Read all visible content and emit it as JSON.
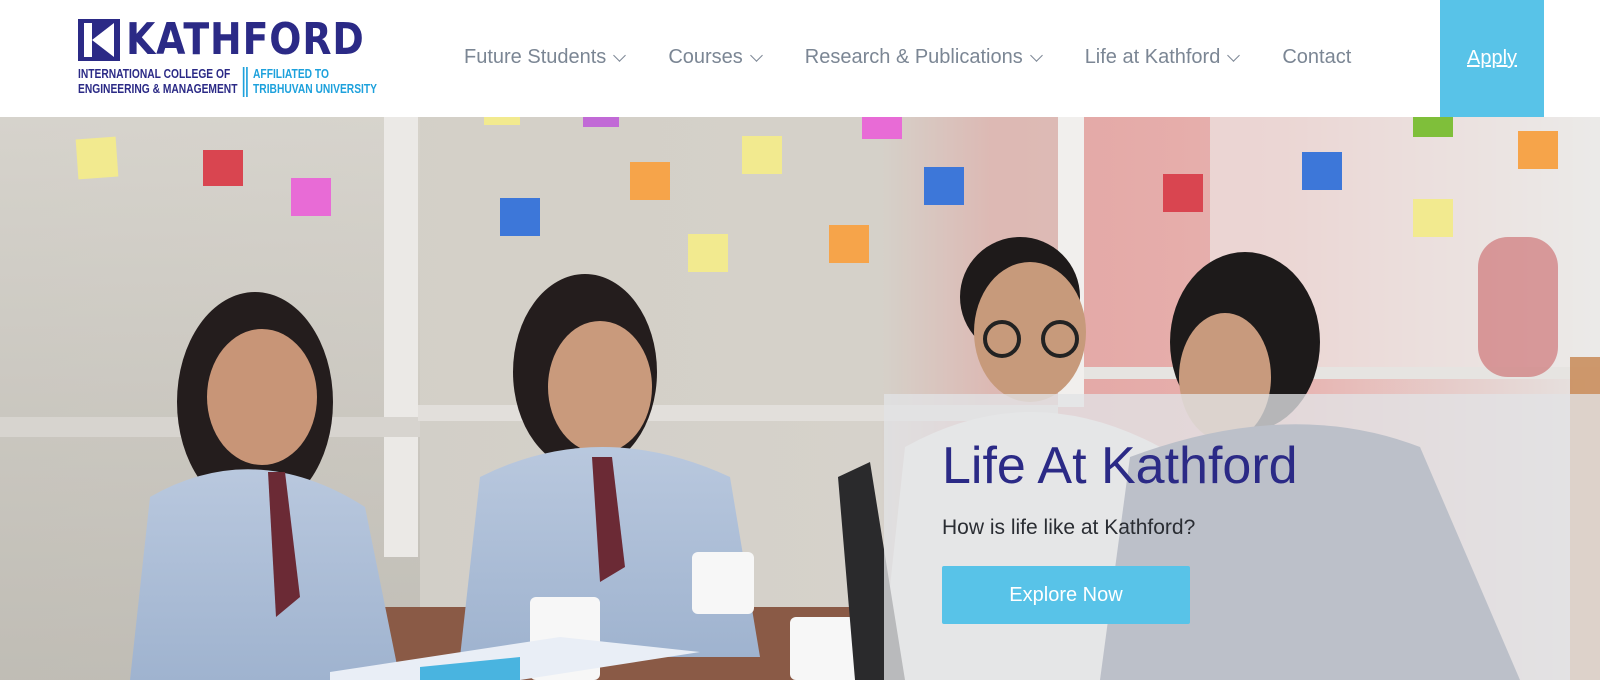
{
  "header": {
    "logo": {
      "name": "KATHFORD",
      "line1_left": "INTERNATIONAL COLLEGE OF",
      "line2_left": "ENGINEERING & MANAGEMENT",
      "line1_right": "AFFILIATED TO",
      "line2_right": "TRIBHUVAN UNIVERSITY"
    },
    "nav": [
      {
        "label": "Future Students",
        "has_dropdown": true
      },
      {
        "label": "Courses",
        "has_dropdown": true
      },
      {
        "label": "Research & Publications",
        "has_dropdown": true
      },
      {
        "label": "Life at Kathford",
        "has_dropdown": true
      },
      {
        "label": "Contact",
        "has_dropdown": false
      }
    ],
    "apply_label": "Apply"
  },
  "hero": {
    "title": "Life At Kathford",
    "subtitle": "How is life like at Kathford?",
    "cta_label": "Explore Now"
  },
  "colors": {
    "brand_navy": "#2b2a86",
    "brand_cyan": "#58c3e8",
    "nav_text": "#7b8694"
  }
}
